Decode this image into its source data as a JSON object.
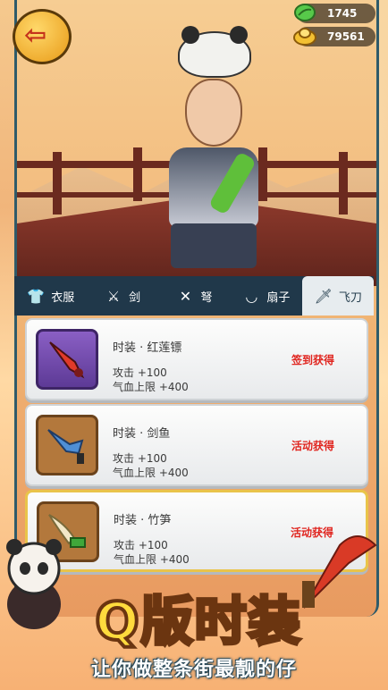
{
  "currency": {
    "gems": "1745",
    "gold": "79561"
  },
  "tabs": [
    {
      "label": "衣服",
      "icon": "clothes-icon"
    },
    {
      "label": "剑",
      "icon": "sword-icon"
    },
    {
      "label": "弩",
      "icon": "crossbow-icon"
    },
    {
      "label": "扇子",
      "icon": "fan-icon"
    },
    {
      "label": "飞刀",
      "icon": "flying-knife-icon"
    }
  ],
  "items": [
    {
      "name": "时装 · 红莲镖",
      "attack": "攻击 +100",
      "hp": "气血上限 +400",
      "source": "签到获得",
      "thumb": "red-lotus-dart-icon"
    },
    {
      "name": "时装 · 剑鱼",
      "attack": "攻击 +100",
      "hp": "气血上限 +400",
      "source": "活动获得",
      "thumb": "swordfish-icon"
    },
    {
      "name": "时装 · 竹笋",
      "attack": "攻击 +100",
      "hp": "气血上限 +400",
      "source": "活动获得",
      "thumb": "bamboo-shoot-icon"
    }
  ],
  "banner": {
    "title": "Q版时装",
    "slogan": "让你做整条街最靓的仔"
  },
  "colors": {
    "tab_bar": "#20384a",
    "source_text": "#e0241e",
    "banner_fill": "#ffdb3d"
  }
}
